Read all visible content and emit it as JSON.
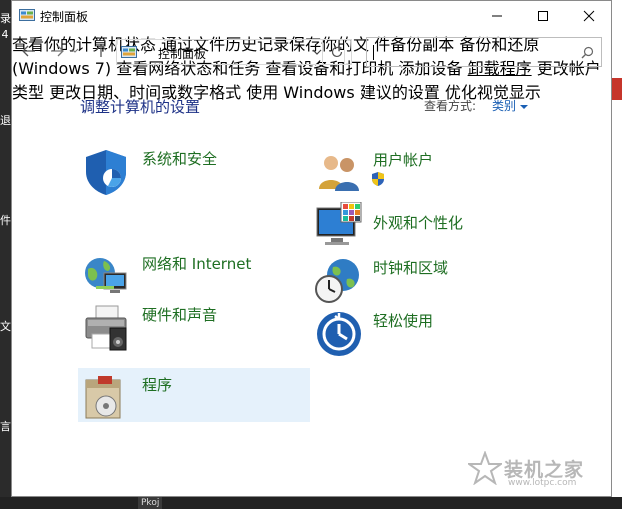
{
  "window": {
    "title": "控制面板"
  },
  "address": {
    "path": "控制面板",
    "separator": "›"
  },
  "search": {
    "placeholder": ""
  },
  "main": {
    "heading": "调整计算机的设置",
    "view_by_label": "查看方式:",
    "view_by_value": "类别",
    "categories": [
      {
        "title": "系统和安全",
        "links": [
          "查看你的计算机状态",
          "通过文件历史记录保存你的文",
          "件备份副本",
          "备份和还原(Windows 7)"
        ]
      },
      {
        "title": "网络和 Internet",
        "links": [
          "查看网络状态和任务"
        ]
      },
      {
        "title": "硬件和声音",
        "links": [
          "查看设备和打印机",
          "添加设备"
        ]
      },
      {
        "title": "程序",
        "links": [
          "卸载程序"
        ]
      },
      {
        "title": "用户帐户",
        "links": [
          "更改帐户类型"
        ]
      },
      {
        "title": "外观和个性化",
        "links": []
      },
      {
        "title": "时钟和区域",
        "links": [
          "更改日期、时间或数字格式"
        ]
      },
      {
        "title": "轻松使用",
        "links": [
          "使用 Windows 建议的设置",
          "优化视觉显示"
        ]
      }
    ]
  },
  "desktop": {
    "left_glyphs": [
      "录",
      "4",
      "退",
      "件",
      "文",
      "言"
    ],
    "taskbar_item": "Pkoj"
  },
  "watermark": {
    "title": "装机之家",
    "url": "www.lotpc.com"
  },
  "colors": {
    "heading": "#1e3287",
    "category_title": "#1e6e22",
    "link": "#1a5fb4",
    "hover_bg": "#e5f1fb"
  }
}
